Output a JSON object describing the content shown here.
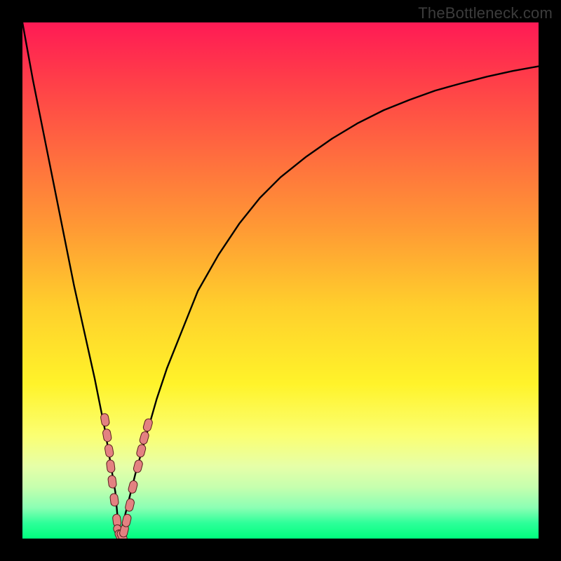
{
  "watermark": "TheBottleneck.com",
  "colors": {
    "frame": "#000000",
    "curve": "#000000",
    "marker_fill": "#e38181",
    "marker_stroke": "#5a1e1e"
  },
  "chart_data": {
    "type": "line",
    "title": "",
    "xlabel": "",
    "ylabel": "",
    "xlim": [
      0,
      100
    ],
    "ylim": [
      0,
      100
    ],
    "grid": false,
    "series": [
      {
        "name": "bottleneck-curve",
        "x": [
          0,
          2,
          4,
          6,
          8,
          10,
          12,
          14,
          16,
          18,
          18.8,
          20,
          22,
          24,
          26,
          28,
          30,
          34,
          38,
          42,
          46,
          50,
          55,
          60,
          65,
          70,
          75,
          80,
          85,
          90,
          95,
          100
        ],
        "values": [
          100,
          89,
          79,
          69,
          59,
          49,
          40,
          31,
          21,
          9,
          0,
          5,
          13,
          20,
          27,
          33,
          38,
          48,
          55,
          61,
          66,
          70,
          74,
          77.5,
          80.5,
          83,
          85,
          86.8,
          88.2,
          89.5,
          90.6,
          91.5
        ]
      }
    ],
    "markers": [
      {
        "x": 16.0,
        "y": 23.0
      },
      {
        "x": 16.4,
        "y": 20.0
      },
      {
        "x": 16.8,
        "y": 17.0
      },
      {
        "x": 17.1,
        "y": 14.0
      },
      {
        "x": 17.4,
        "y": 11.0
      },
      {
        "x": 17.8,
        "y": 7.5
      },
      {
        "x": 18.3,
        "y": 3.5
      },
      {
        "x": 18.6,
        "y": 1.5
      },
      {
        "x": 18.9,
        "y": 0.5
      },
      {
        "x": 19.3,
        "y": 0.5
      },
      {
        "x": 19.7,
        "y": 1.5
      },
      {
        "x": 20.2,
        "y": 3.5
      },
      {
        "x": 20.8,
        "y": 6.5
      },
      {
        "x": 21.4,
        "y": 10.0
      },
      {
        "x": 22.4,
        "y": 14.0
      },
      {
        "x": 23.0,
        "y": 17.0
      },
      {
        "x": 23.6,
        "y": 19.5
      },
      {
        "x": 24.3,
        "y": 22.0
      }
    ]
  }
}
